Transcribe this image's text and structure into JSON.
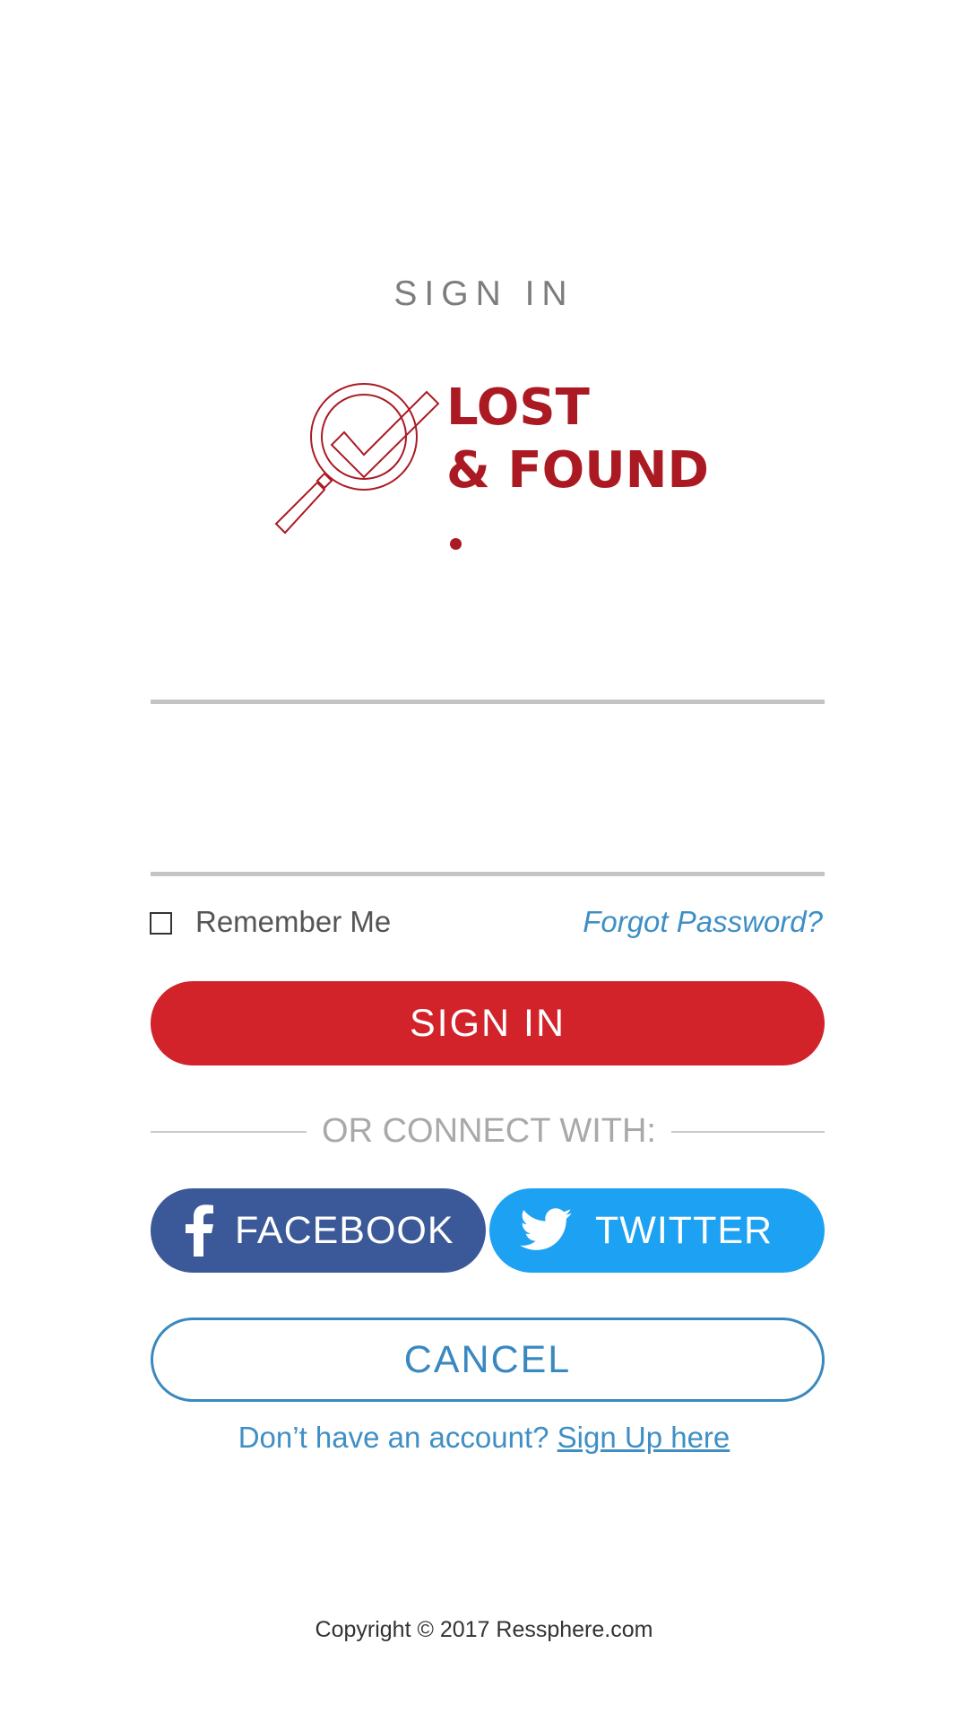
{
  "colors": {
    "brand_red": "#d2222a",
    "logo_red": "#ab1a23",
    "link_blue": "#3f8fc5",
    "facebook_blue": "#3b5998",
    "twitter_blue": "#1da1f2",
    "cancel_blue": "#3a88c0"
  },
  "header": {
    "title": "SIGN IN"
  },
  "logo": {
    "icon": "magnifier-check-icon",
    "line1": "LOST",
    "line2": "& FOUND"
  },
  "form": {
    "username_value": "",
    "password_value": "",
    "remember_label": "Remember Me",
    "remember_checked": false,
    "forgot_label": "Forgot Password?",
    "submit_label": "SIGN IN"
  },
  "social": {
    "divider_label": "OR CONNECT WITH:",
    "facebook_label": "FACEBOOK",
    "facebook_icon": "facebook-icon",
    "twitter_label": "TWITTER",
    "twitter_icon": "twitter-icon"
  },
  "cancel_label": "CANCEL",
  "signup": {
    "prompt": "Don’t have an account? ",
    "link_label": "Sign Up here"
  },
  "footer": {
    "copyright": "Copyright © 2017 Ressphere.com"
  }
}
